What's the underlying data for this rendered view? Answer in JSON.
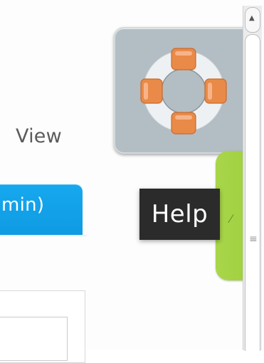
{
  "content": {
    "view_label": "View",
    "blue_tab_label": "min)"
  },
  "help_widget": {
    "tooltip_label": "Help",
    "icon_name": "lifebuoy-icon",
    "card_color": "#b3bdc4",
    "tab_color": "#a6d445"
  },
  "scrollbar": {
    "up_arrow_icon": "chevron-up-icon",
    "grip_icon": "grip-icon"
  },
  "colors": {
    "accent_blue": "#15a5ec",
    "tooltip_bg": "#2b2b2b",
    "lifebuoy_orange": "#e98a48"
  }
}
